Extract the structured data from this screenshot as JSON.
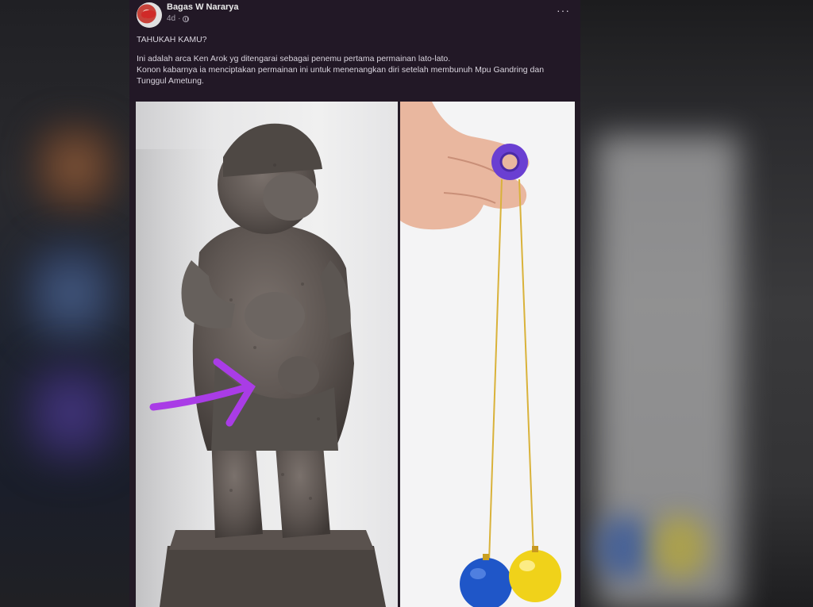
{
  "post": {
    "author": "Bagas W Nararya",
    "time": "4d",
    "more_label": "···",
    "headline": "TAHUKAH KAMU?",
    "body_line1": "Ini adalah arca Ken Arok yg ditengarai sebagai penemu pertama permainan lato-lato.",
    "body_line2": "Konon kabarnya ia menciptakan permainan ini untuk menenangkan diri setelah membunuh Mpu Gandring dan Tunggul Ametung."
  },
  "icons": {
    "avatar": "profile-avatar",
    "privacy": "globe-icon",
    "more": "more-options-icon"
  },
  "colors": {
    "post_bg": "#221826",
    "arrow": "#a93ce6",
    "clacker_ring": "#6a3fd2",
    "ball_blue": "#1f56c8",
    "ball_yellow": "#f0d21a"
  }
}
